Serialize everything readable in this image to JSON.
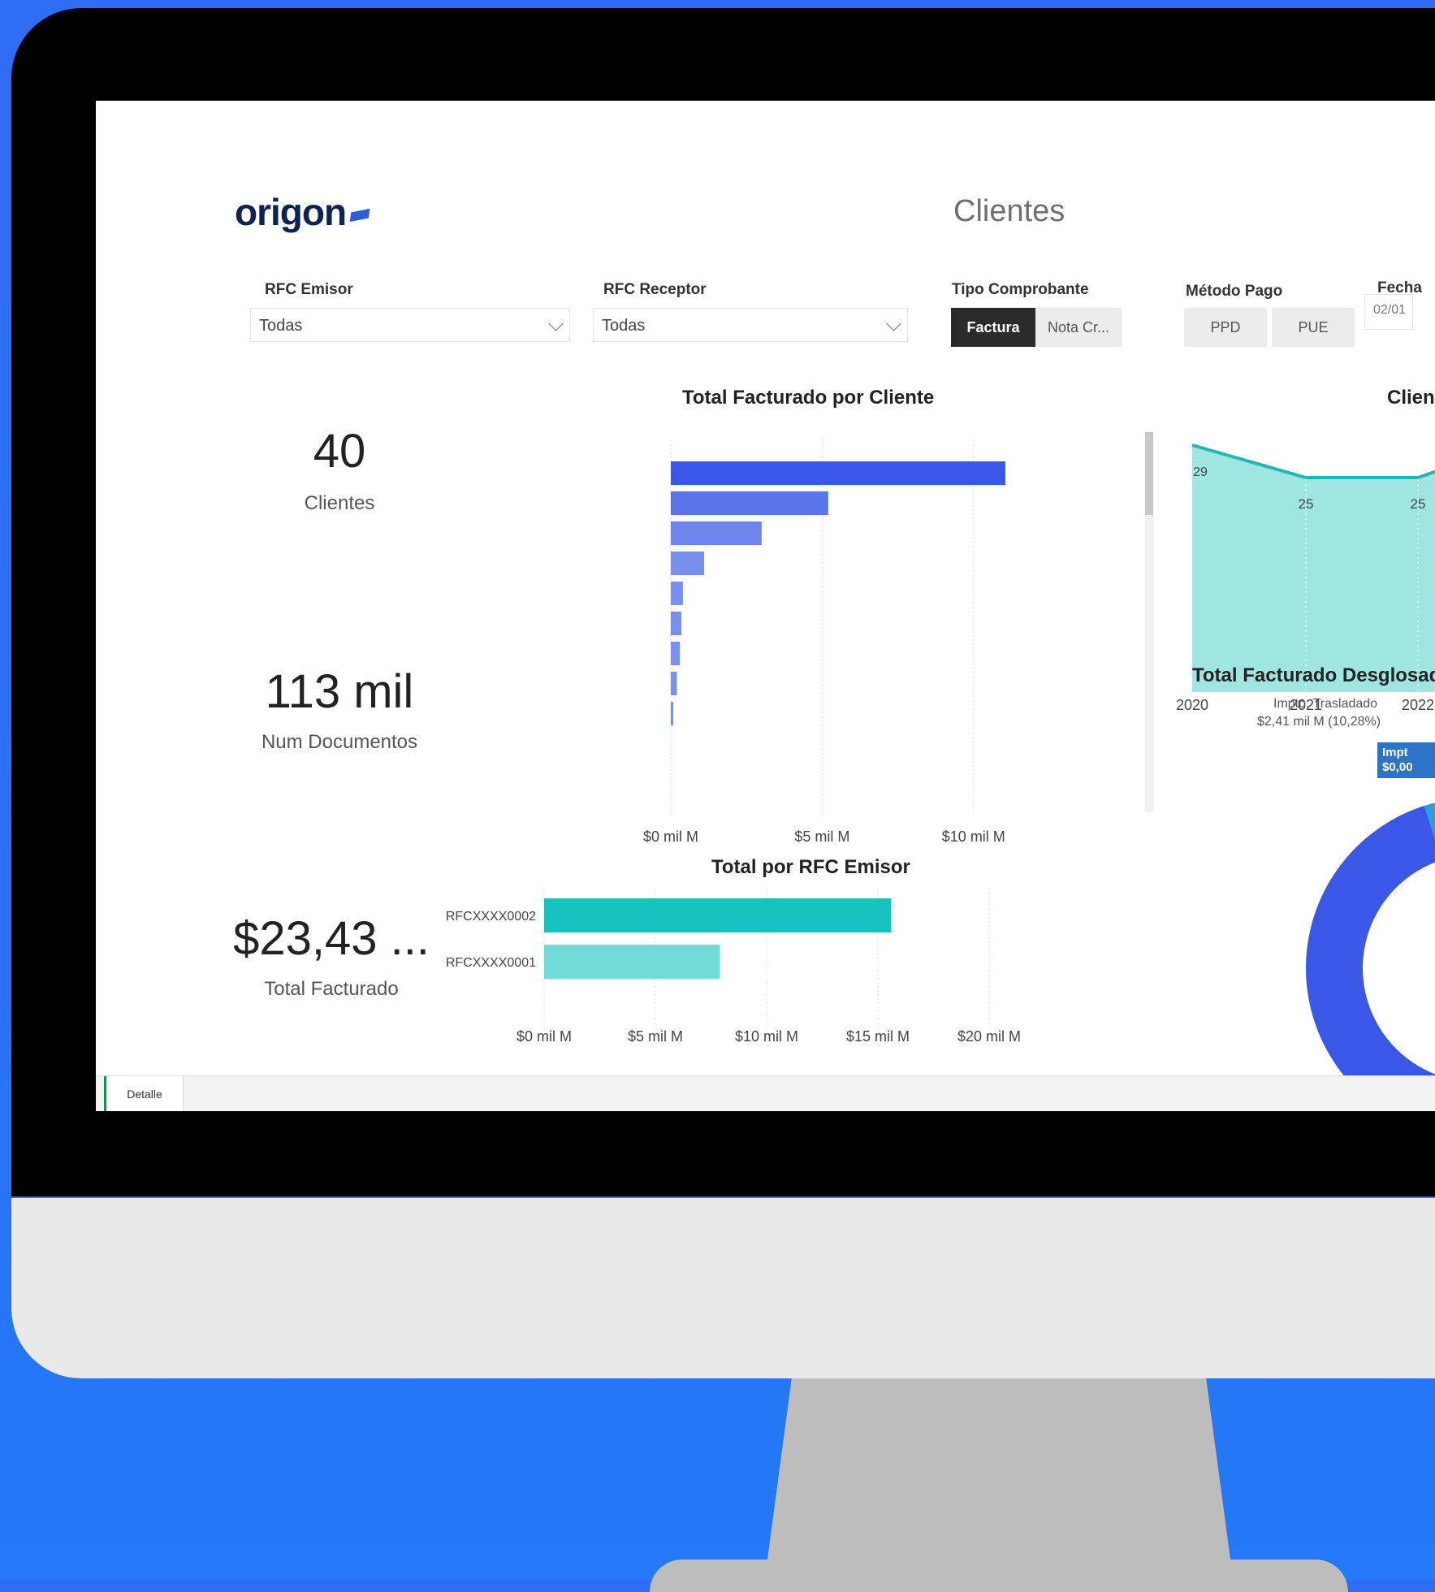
{
  "brand": {
    "name": "origon",
    "colors": {
      "accent": "#2c5fe0",
      "teal": "#16c2bd",
      "background": "#2f6df2"
    }
  },
  "page": {
    "title": "Clientes"
  },
  "filters": {
    "rfc_emisor": {
      "label": "RFC Emisor",
      "value": "Todas"
    },
    "rfc_receptor": {
      "label": "RFC Receptor",
      "value": "Todas"
    },
    "tipo_comprobante": {
      "label": "Tipo Comprobante",
      "options": [
        "Factura",
        "Nota Cr..."
      ],
      "selected": "Factura"
    },
    "metodo_pago": {
      "label": "Método Pago",
      "options": [
        "PPD",
        "PUE"
      ]
    },
    "fecha": {
      "label": "Fecha",
      "value": "02/01"
    }
  },
  "kpis": {
    "clientes": {
      "value": "40",
      "label": "Clientes"
    },
    "documentos": {
      "value": "113 mil",
      "label": "Num Documentos"
    },
    "facturado": {
      "value": "$23,43 ...",
      "label": "Total Facturado"
    }
  },
  "chart_data": [
    {
      "type": "bar",
      "orientation": "horizontal",
      "title": "Total Facturado por Cliente",
      "xlim": [
        0,
        12.5
      ],
      "xticks": [
        "$0 mil M",
        "$5 mil M",
        "$10 mil M"
      ],
      "values": [
        12.5,
        5.2,
        3.0,
        1.1,
        0.4,
        0.35,
        0.3,
        0.2,
        0.08
      ],
      "color": "#3f5be8"
    },
    {
      "type": "bar",
      "orientation": "horizontal",
      "title": "Total por RFC Emisor",
      "categories": [
        "RFCXXXX0002",
        "RFCXXXX0001"
      ],
      "values": [
        15.6,
        7.9
      ],
      "xlim": [
        0,
        20
      ],
      "xticks": [
        "$0 mil M",
        "$5 mil M",
        "$10 mil M",
        "$15 mil M",
        "$20 mil M"
      ],
      "colors": [
        "#16c2bd",
        "#72dad7"
      ]
    },
    {
      "type": "area",
      "title": "Client",
      "x": [
        "2020",
        "2021",
        "2022"
      ],
      "values": [
        29,
        25,
        25
      ],
      "color": "#9fe6e3",
      "line_color": "#22b7b3"
    },
    {
      "type": "pie",
      "title": "Total Facturado Desglosado:",
      "annotations": [
        {
          "label": "Impto. Trasladado",
          "value": "$2,41 mil M (10,28%)"
        },
        {
          "label": "Impt",
          "value": "$0,00"
        }
      ]
    }
  ],
  "footer": {
    "tab": "Detalle"
  }
}
